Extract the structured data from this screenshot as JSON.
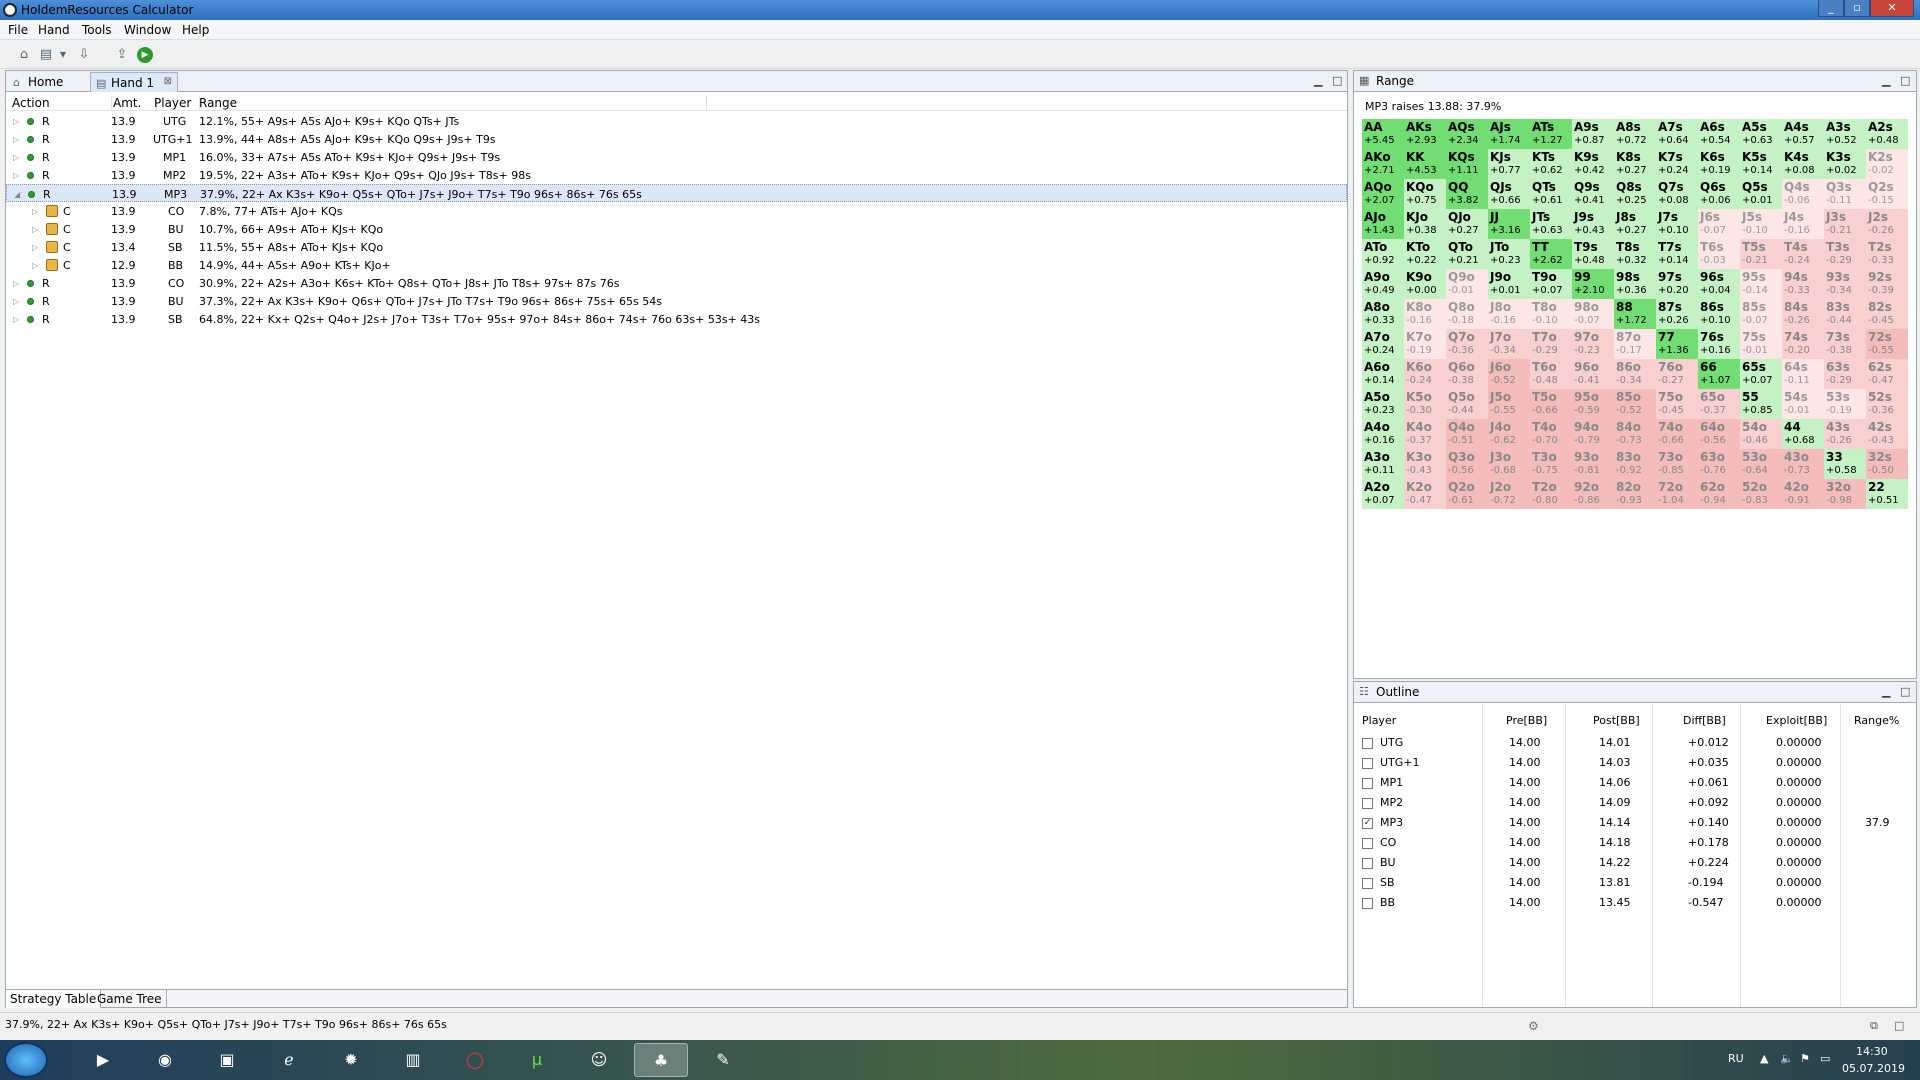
{
  "window": {
    "title": "HoldemResources Calculator"
  },
  "menu": [
    "File",
    "Hand",
    "Tools",
    "Window",
    "Help"
  ],
  "tabs": {
    "home": "Home",
    "hand": "Hand 1"
  },
  "strategy": {
    "columns": [
      "Action",
      "Amt.",
      "Player",
      "Range"
    ],
    "rows": [
      {
        "action": "R",
        "amt": "13.9",
        "player": "UTG",
        "range": "12.1%, 55+ A9s+ A5s AJo+ K9s+ KQo QTs+ JTs",
        "indent": 0,
        "lock": false,
        "sel": false
      },
      {
        "action": "R",
        "amt": "13.9",
        "player": "UTG+1",
        "range": "13.9%, 44+ A8s+ A5s AJo+ K9s+ KQo Q9s+ J9s+ T9s",
        "indent": 0,
        "lock": false,
        "sel": false
      },
      {
        "action": "R",
        "amt": "13.9",
        "player": "MP1",
        "range": "16.0%, 33+ A7s+ A5s ATo+ K9s+ KJo+ Q9s+ J9s+ T9s",
        "indent": 0,
        "lock": false,
        "sel": false
      },
      {
        "action": "R",
        "amt": "13.9",
        "player": "MP2",
        "range": "19.5%, 22+ A3s+ ATo+ K9s+ KJo+ Q9s+ QJo J9s+ T8s+ 98s",
        "indent": 0,
        "lock": false,
        "sel": false
      },
      {
        "action": "R",
        "amt": "13.9",
        "player": "MP3",
        "range": "37.9%, 22+ Ax K3s+ K9o+ Q5s+ QTo+ J7s+ J9o+ T7s+ T9o 96s+ 86s+ 76s 65s",
        "indent": 0,
        "lock": false,
        "sel": true
      },
      {
        "action": "C",
        "amt": "13.9",
        "player": "CO",
        "range": "7.8%, 77+ ATs+ AJo+ KQs",
        "indent": 1,
        "lock": true,
        "sel": false
      },
      {
        "action": "C",
        "amt": "13.9",
        "player": "BU",
        "range": "10.7%, 66+ A9s+ ATo+ KJs+ KQo",
        "indent": 1,
        "lock": true,
        "sel": false
      },
      {
        "action": "C",
        "amt": "13.4",
        "player": "SB",
        "range": "11.5%, 55+ A8s+ ATo+ KJs+ KQo",
        "indent": 1,
        "lock": true,
        "sel": false
      },
      {
        "action": "C",
        "amt": "12.9",
        "player": "BB",
        "range": "14.9%, 44+ A5s+ A9o+ KTs+ KJo+",
        "indent": 1,
        "lock": true,
        "sel": false
      },
      {
        "action": "R",
        "amt": "13.9",
        "player": "CO",
        "range": "30.9%, 22+ A2s+ A3o+ K6s+ KTo+ Q8s+ QTo+ J8s+ JTo T8s+ 97s+ 87s 76s",
        "indent": 0,
        "lock": false,
        "sel": false
      },
      {
        "action": "R",
        "amt": "13.9",
        "player": "BU",
        "range": "37.3%, 22+ Ax K3s+ K9o+ Q6s+ QTo+ J7s+ JTo T7s+ T9o 96s+ 86s+ 75s+ 65s 54s",
        "indent": 0,
        "lock": false,
        "sel": false
      },
      {
        "action": "R",
        "amt": "13.9",
        "player": "SB",
        "range": "64.8%, 22+ Kx+ Q2s+ Q4o+ J2s+ J7o+ T3s+ T7o+ 95s+ 97o+ 84s+ 86o+ 74s+ 76o 63s+ 53s+ 43s",
        "indent": 0,
        "lock": false,
        "sel": false
      }
    ]
  },
  "bottom_tabs": [
    "Strategy Table",
    "Game Tree"
  ],
  "range_panel": {
    "title": "Range",
    "info": "MP3 raises 13.88: 37.9%",
    "grid": [
      [
        "AA",
        "+5.45"
      ],
      [
        "AKs",
        "+2.93"
      ],
      [
        "AQs",
        "+2.34"
      ],
      [
        "AJs",
        "+1.74"
      ],
      [
        "ATs",
        "+1.27"
      ],
      [
        "A9s",
        "+0.87"
      ],
      [
        "A8s",
        "+0.72"
      ],
      [
        "A7s",
        "+0.64"
      ],
      [
        "A6s",
        "+0.54"
      ],
      [
        "A5s",
        "+0.63"
      ],
      [
        "A4s",
        "+0.57"
      ],
      [
        "A3s",
        "+0.52"
      ],
      [
        "A2s",
        "+0.48"
      ],
      [
        "AKo",
        "+2.71"
      ],
      [
        "KK",
        "+4.53"
      ],
      [
        "KQs",
        "+1.11"
      ],
      [
        "KJs",
        "+0.77"
      ],
      [
        "KTs",
        "+0.62"
      ],
      [
        "K9s",
        "+0.42"
      ],
      [
        "K8s",
        "+0.27"
      ],
      [
        "K7s",
        "+0.24"
      ],
      [
        "K6s",
        "+0.19"
      ],
      [
        "K5s",
        "+0.14"
      ],
      [
        "K4s",
        "+0.08"
      ],
      [
        "K3s",
        "+0.02"
      ],
      [
        "K2s",
        "-0.02"
      ],
      [
        "AQo",
        "+2.07"
      ],
      [
        "KQo",
        "+0.75"
      ],
      [
        "QQ",
        "+3.82"
      ],
      [
        "QJs",
        "+0.66"
      ],
      [
        "QTs",
        "+0.61"
      ],
      [
        "Q9s",
        "+0.41"
      ],
      [
        "Q8s",
        "+0.25"
      ],
      [
        "Q7s",
        "+0.08"
      ],
      [
        "Q6s",
        "+0.06"
      ],
      [
        "Q5s",
        "+0.01"
      ],
      [
        "Q4s",
        "-0.06"
      ],
      [
        "Q3s",
        "-0.11"
      ],
      [
        "Q2s",
        "-0.15"
      ],
      [
        "AJo",
        "+1.43"
      ],
      [
        "KJo",
        "+0.38"
      ],
      [
        "QJo",
        "+0.27"
      ],
      [
        "JJ",
        "+3.16"
      ],
      [
        "JTs",
        "+0.63"
      ],
      [
        "J9s",
        "+0.43"
      ],
      [
        "J8s",
        "+0.27"
      ],
      [
        "J7s",
        "+0.10"
      ],
      [
        "J6s",
        "-0.07"
      ],
      [
        "J5s",
        "-0.10"
      ],
      [
        "J4s",
        "-0.16"
      ],
      [
        "J3s",
        "-0.21"
      ],
      [
        "J2s",
        "-0.26"
      ],
      [
        "ATo",
        "+0.92"
      ],
      [
        "KTo",
        "+0.22"
      ],
      [
        "QTo",
        "+0.21"
      ],
      [
        "JTo",
        "+0.23"
      ],
      [
        "TT",
        "+2.62"
      ],
      [
        "T9s",
        "+0.48"
      ],
      [
        "T8s",
        "+0.32"
      ],
      [
        "T7s",
        "+0.14"
      ],
      [
        "T6s",
        "-0.03"
      ],
      [
        "T5s",
        "-0.21"
      ],
      [
        "T4s",
        "-0.24"
      ],
      [
        "T3s",
        "-0.29"
      ],
      [
        "T2s",
        "-0.33"
      ],
      [
        "A9o",
        "+0.49"
      ],
      [
        "K9o",
        "+0.00"
      ],
      [
        "Q9o",
        "-0.01"
      ],
      [
        "J9o",
        "+0.01"
      ],
      [
        "T9o",
        "+0.07"
      ],
      [
        "99",
        "+2.10"
      ],
      [
        "98s",
        "+0.36"
      ],
      [
        "97s",
        "+0.20"
      ],
      [
        "96s",
        "+0.04"
      ],
      [
        "95s",
        "-0.14"
      ],
      [
        "94s",
        "-0.33"
      ],
      [
        "93s",
        "-0.34"
      ],
      [
        "92s",
        "-0.39"
      ],
      [
        "A8o",
        "+0.33"
      ],
      [
        "K8o",
        "-0.16"
      ],
      [
        "Q8o",
        "-0.18"
      ],
      [
        "J8o",
        "-0.16"
      ],
      [
        "T8o",
        "-0.10"
      ],
      [
        "98o",
        "-0.07"
      ],
      [
        "88",
        "+1.72"
      ],
      [
        "87s",
        "+0.26"
      ],
      [
        "86s",
        "+0.10"
      ],
      [
        "85s",
        "-0.07"
      ],
      [
        "84s",
        "-0.26"
      ],
      [
        "83s",
        "-0.44"
      ],
      [
        "82s",
        "-0.45"
      ],
      [
        "A7o",
        "+0.24"
      ],
      [
        "K7o",
        "-0.19"
      ],
      [
        "Q7o",
        "-0.36"
      ],
      [
        "J7o",
        "-0.34"
      ],
      [
        "T7o",
        "-0.29"
      ],
      [
        "97o",
        "-0.23"
      ],
      [
        "87o",
        "-0.17"
      ],
      [
        "77",
        "+1.36"
      ],
      [
        "76s",
        "+0.16"
      ],
      [
        "75s",
        "-0.01"
      ],
      [
        "74s",
        "-0.20"
      ],
      [
        "73s",
        "-0.38"
      ],
      [
        "72s",
        "-0.55"
      ],
      [
        "A6o",
        "+0.14"
      ],
      [
        "K6o",
        "-0.24"
      ],
      [
        "Q6o",
        "-0.38"
      ],
      [
        "J6o",
        "-0.52"
      ],
      [
        "T6o",
        "-0.48"
      ],
      [
        "96o",
        "-0.41"
      ],
      [
        "86o",
        "-0.34"
      ],
      [
        "76o",
        "-0.27"
      ],
      [
        "66",
        "+1.07"
      ],
      [
        "65s",
        "+0.07"
      ],
      [
        "64s",
        "-0.11"
      ],
      [
        "63s",
        "-0.29"
      ],
      [
        "62s",
        "-0.47"
      ],
      [
        "A5o",
        "+0.23"
      ],
      [
        "K5o",
        "-0.30"
      ],
      [
        "Q5o",
        "-0.44"
      ],
      [
        "J5o",
        "-0.55"
      ],
      [
        "T5o",
        "-0.66"
      ],
      [
        "95o",
        "-0.59"
      ],
      [
        "85o",
        "-0.52"
      ],
      [
        "75o",
        "-0.45"
      ],
      [
        "65o",
        "-0.37"
      ],
      [
        "55",
        "+0.85"
      ],
      [
        "54s",
        "-0.01"
      ],
      [
        "53s",
        "-0.19"
      ],
      [
        "52s",
        "-0.36"
      ],
      [
        "A4o",
        "+0.16"
      ],
      [
        "K4o",
        "-0.37"
      ],
      [
        "Q4o",
        "-0.51"
      ],
      [
        "J4o",
        "-0.62"
      ],
      [
        "T4o",
        "-0.70"
      ],
      [
        "94o",
        "-0.79"
      ],
      [
        "84o",
        "-0.73"
      ],
      [
        "74o",
        "-0.66"
      ],
      [
        "64o",
        "-0.56"
      ],
      [
        "54o",
        "-0.46"
      ],
      [
        "44",
        "+0.68"
      ],
      [
        "43s",
        "-0.26"
      ],
      [
        "42s",
        "-0.43"
      ],
      [
        "A3o",
        "+0.11"
      ],
      [
        "K3o",
        "-0.43"
      ],
      [
        "Q3o",
        "-0.56"
      ],
      [
        "J3o",
        "-0.68"
      ],
      [
        "T3o",
        "-0.75"
      ],
      [
        "93o",
        "-0.81"
      ],
      [
        "83o",
        "-0.92"
      ],
      [
        "73o",
        "-0.85"
      ],
      [
        "63o",
        "-0.76"
      ],
      [
        "53o",
        "-0.64"
      ],
      [
        "43o",
        "-0.73"
      ],
      [
        "33",
        "+0.58"
      ],
      [
        "32s",
        "-0.50"
      ],
      [
        "A2o",
        "+0.07"
      ],
      [
        "K2o",
        "-0.47"
      ],
      [
        "Q2o",
        "-0.61"
      ],
      [
        "J2o",
        "-0.72"
      ],
      [
        "T2o",
        "-0.80"
      ],
      [
        "92o",
        "-0.86"
      ],
      [
        "82o",
        "-0.93"
      ],
      [
        "72o",
        "-1.04"
      ],
      [
        "62o",
        "-0.94"
      ],
      [
        "52o",
        "-0.83"
      ],
      [
        "42o",
        "-0.91"
      ],
      [
        "32o",
        "-0.98"
      ],
      [
        "22",
        "+0.51"
      ]
    ]
  },
  "outline": {
    "title": "Outline",
    "columns": [
      "Player",
      "Pre[BB]",
      "Post[BB]",
      "Diff[BB]",
      "Exploit[BB]",
      "Range%"
    ],
    "rows": [
      {
        "player": "UTG",
        "pre": "14.00",
        "post": "14.01",
        "diff": "+0.012",
        "exploit": "0.00000",
        "range": "",
        "checked": false
      },
      {
        "player": "UTG+1",
        "pre": "14.00",
        "post": "14.03",
        "diff": "+0.035",
        "exploit": "0.00000",
        "range": "",
        "checked": false
      },
      {
        "player": "MP1",
        "pre": "14.00",
        "post": "14.06",
        "diff": "+0.061",
        "exploit": "0.00000",
        "range": "",
        "checked": false
      },
      {
        "player": "MP2",
        "pre": "14.00",
        "post": "14.09",
        "diff": "+0.092",
        "exploit": "0.00000",
        "range": "",
        "checked": false
      },
      {
        "player": "MP3",
        "pre": "14.00",
        "post": "14.14",
        "diff": "+0.140",
        "exploit": "0.00000",
        "range": "37.9",
        "checked": true
      },
      {
        "player": "CO",
        "pre": "14.00",
        "post": "14.18",
        "diff": "+0.178",
        "exploit": "0.00000",
        "range": "",
        "checked": false
      },
      {
        "player": "BU",
        "pre": "14.00",
        "post": "14.22",
        "diff": "+0.224",
        "exploit": "0.00000",
        "range": "",
        "checked": false
      },
      {
        "player": "SB",
        "pre": "14.00",
        "post": "13.81",
        "diff": "-0.194",
        "exploit": "0.00000",
        "range": "",
        "checked": false
      },
      {
        "player": "BB",
        "pre": "14.00",
        "post": "13.45",
        "diff": "-0.547",
        "exploit": "0.00000",
        "range": "",
        "checked": false
      }
    ]
  },
  "status_text": "37.9%, 22+ Ax K3s+ K9o+ Q5s+ QTo+ J7s+ J9o+ T7s+ T9o 96s+ 86s+ 76s 65s",
  "taskbar": {
    "lang": "RU",
    "time": "14:30",
    "date": "05.07.2019"
  },
  "colors": {
    "raise_green": "#7ee07e",
    "fold_red": "#f8c8c8",
    "neutral": "#ffffff"
  }
}
